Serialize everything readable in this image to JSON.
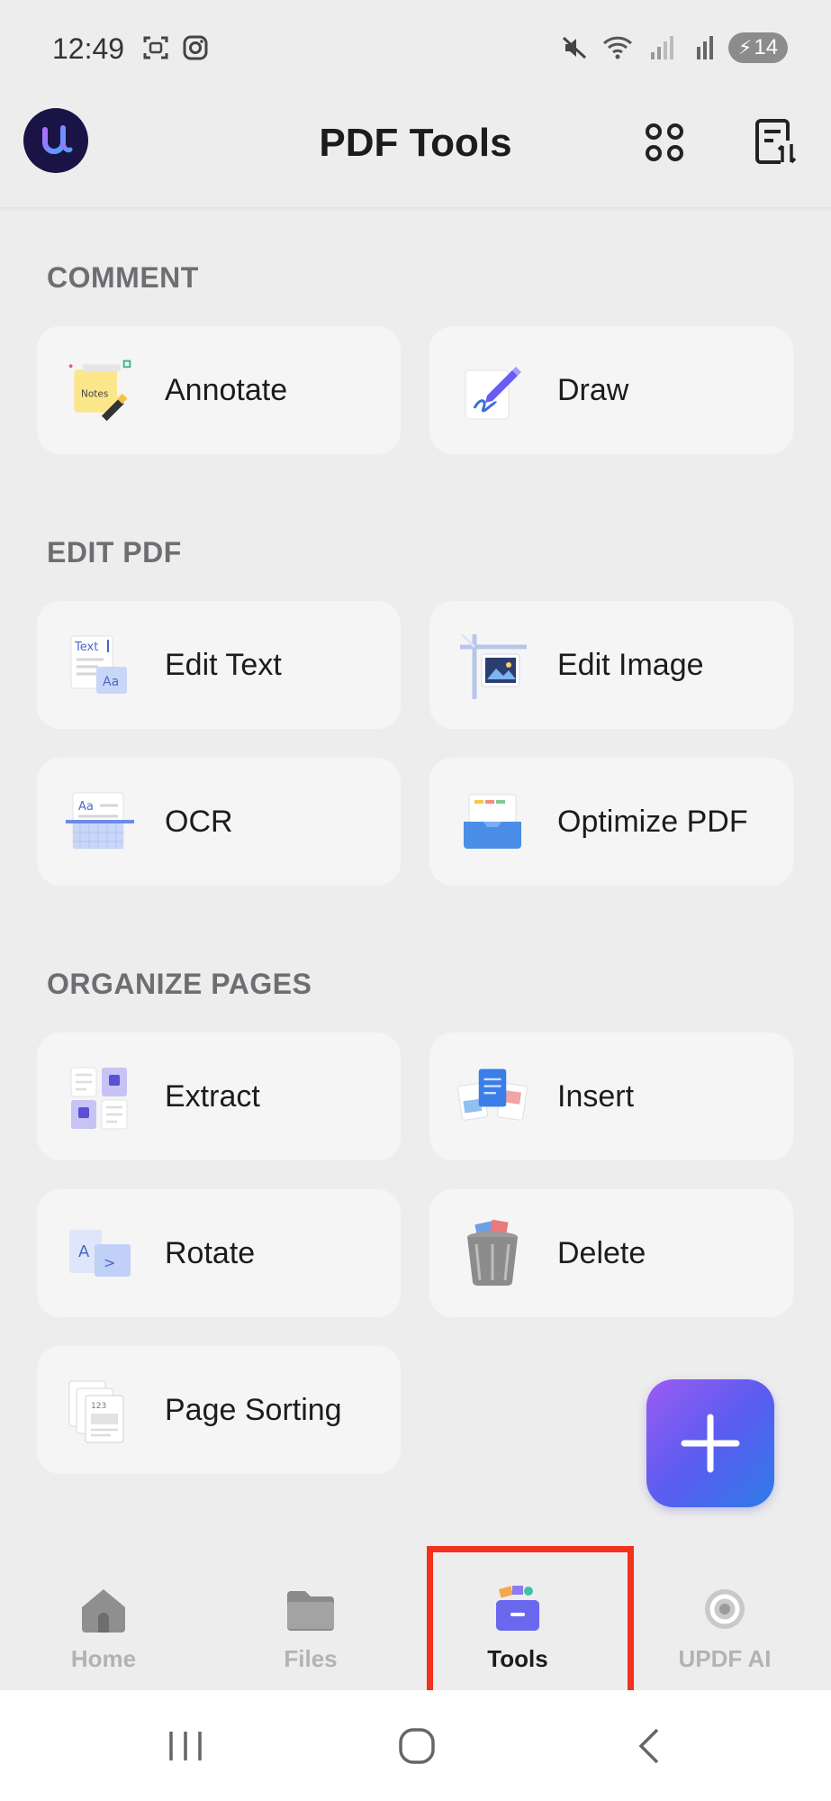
{
  "status": {
    "time": "12:49",
    "battery": "14"
  },
  "app": {
    "title": "PDF Tools"
  },
  "sections": {
    "comment": "COMMENT",
    "edit": "EDIT PDF",
    "organize": "ORGANIZE PAGES"
  },
  "tools": {
    "annotate": "Annotate",
    "draw": "Draw",
    "edit_text": "Edit Text",
    "edit_image": "Edit Image",
    "ocr": "OCR",
    "optimize": "Optimize PDF",
    "extract": "Extract",
    "insert": "Insert",
    "rotate": "Rotate",
    "delete": "Delete",
    "page_sorting": "Page Sorting"
  },
  "icon_text": {
    "notes": "Notes",
    "text": "Text",
    "aa": "Aa",
    "a": "A",
    "num": "123"
  },
  "nav": {
    "home": "Home",
    "files": "Files",
    "tools": "Tools",
    "ai": "UPDF AI",
    "active": "tools"
  },
  "colors": {
    "accent_start": "#9b5cf2",
    "accent_end": "#2f7be8",
    "highlight": "#f2311e"
  }
}
